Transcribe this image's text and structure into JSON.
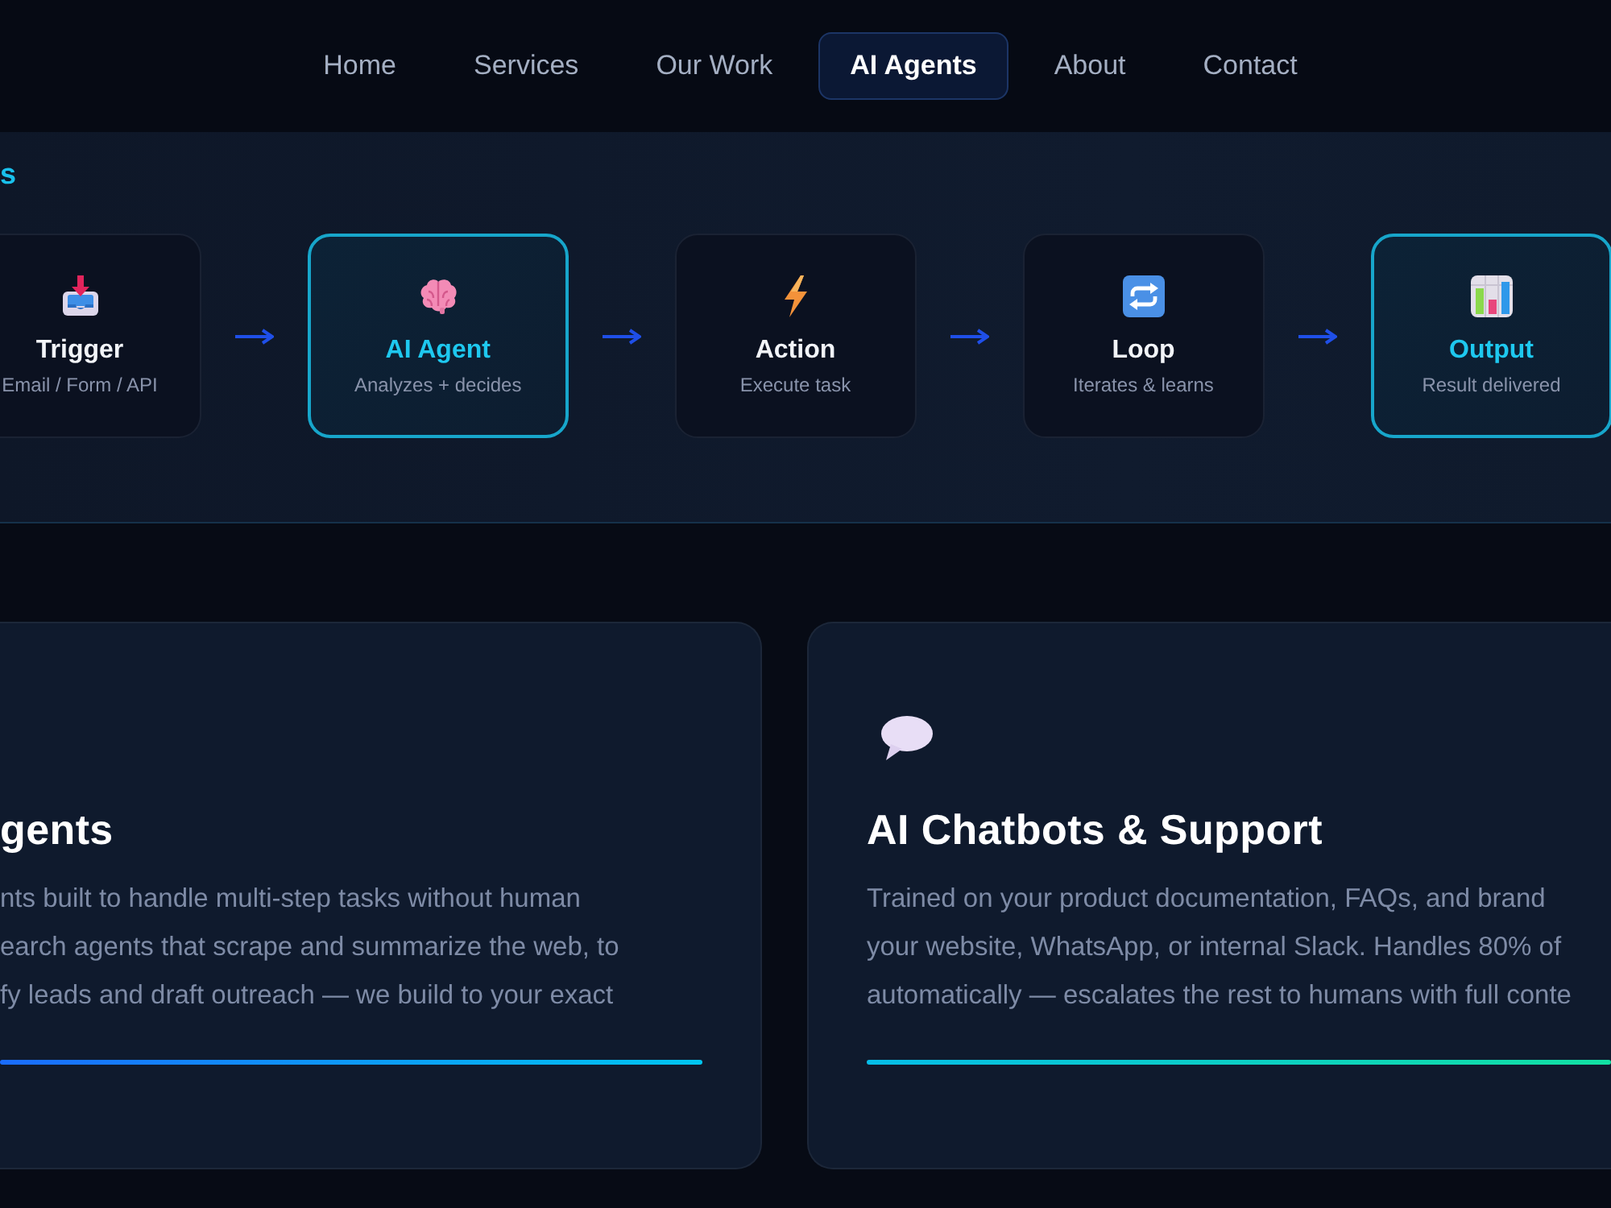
{
  "nav": {
    "items": [
      {
        "label": "Home",
        "selected": false
      },
      {
        "label": "Services",
        "selected": false
      },
      {
        "label": "Our Work",
        "selected": false
      },
      {
        "label": "AI Agents",
        "selected": true
      },
      {
        "label": "About",
        "selected": false
      },
      {
        "label": "Contact",
        "selected": false
      }
    ]
  },
  "workflow": {
    "heading": "s",
    "steps": [
      {
        "title": "Trigger",
        "subtitle": "Email / Form / API",
        "highlighted": false
      },
      {
        "title": "AI Agent",
        "subtitle": "Analyzes + decides",
        "highlighted": true
      },
      {
        "title": "Action",
        "subtitle": "Execute task",
        "highlighted": false
      },
      {
        "title": "Loop",
        "subtitle": "Iterates & learns",
        "highlighted": false
      },
      {
        "title": "Output",
        "subtitle": "Result delivered",
        "highlighted": true
      }
    ]
  },
  "services": {
    "cards": [
      {
        "title": "gents",
        "description_lines": [
          "nts built to handle multi-step tasks without human",
          "earch agents that scrape and summarize the web, to",
          "fy leads and draft outreach — we build to your exact"
        ]
      },
      {
        "title": "AI Chatbots & Support",
        "description_lines": [
          "Trained on your product documentation, FAQs, and brand",
          "your website, WhatsApp, or internal Slack. Handles 80% of",
          "automatically — escalates the rest to humans with full conte"
        ]
      }
    ]
  }
}
